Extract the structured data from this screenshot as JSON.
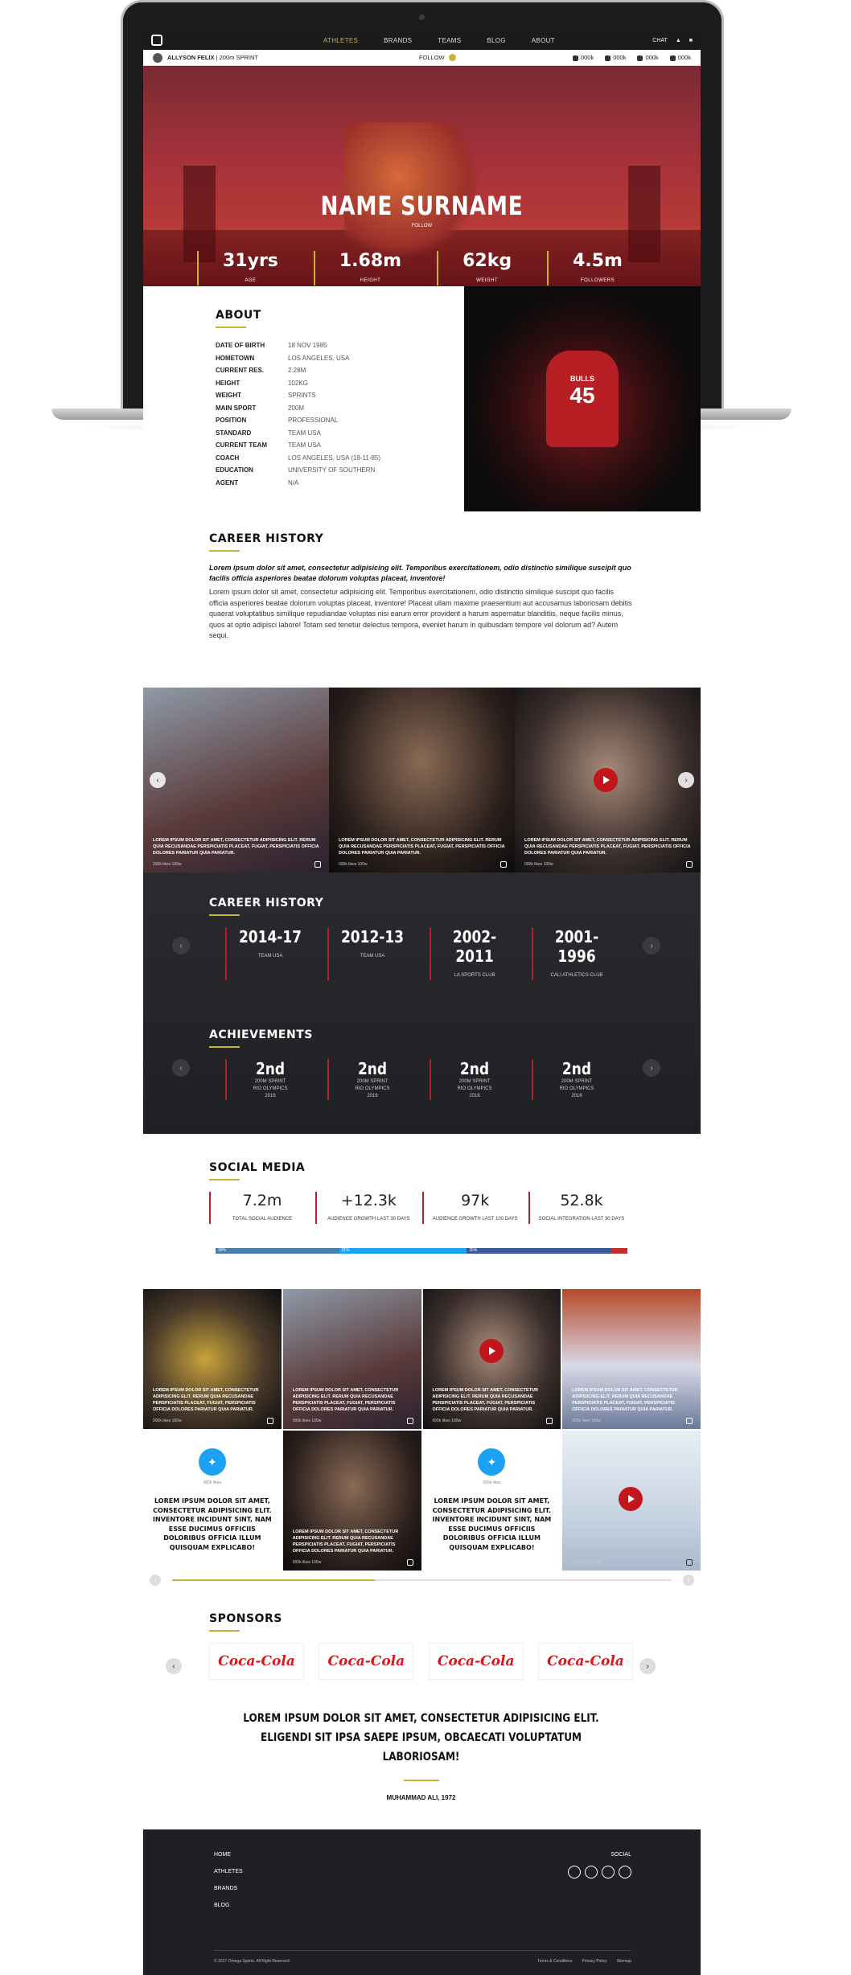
{
  "nav": {
    "items": [
      "ATHLETES",
      "BRANDS",
      "TEAMS",
      "BLOG",
      "ABOUT"
    ],
    "active": "ATHLETES",
    "chat": "CHAT"
  },
  "subbar": {
    "athlete": "ALLYSON FELIX",
    "event": "200m SPRINT",
    "follow": "FOLLOW",
    "youtube": "000k",
    "instagram": "000k",
    "twitter": "000k",
    "facebook": "000k"
  },
  "hero": {
    "name": "NAME SURNAME",
    "follow": "FOLLOW",
    "stats": [
      {
        "value": "31yrs",
        "label": "AGE"
      },
      {
        "value": "1.68m",
        "label": "HEIGHT"
      },
      {
        "value": "62kg",
        "label": "WEIGHT"
      },
      {
        "value": "4.5m",
        "label": "FOLLOWERS"
      }
    ]
  },
  "about": {
    "title": "ABOUT",
    "rows": [
      {
        "k": "DATE OF BIRTH",
        "v": "18 NOV 1985"
      },
      {
        "k": "HOMETOWN",
        "v": "LOS ANGELES, USA"
      },
      {
        "k": "CURRENT RES.",
        "v": "2.28M"
      },
      {
        "k": "HEIGHT",
        "v": "102KG"
      },
      {
        "k": "WEIGHT",
        "v": "SPRINTS"
      },
      {
        "k": "MAIN SPORT",
        "v": "200M"
      },
      {
        "k": "POSITION",
        "v": "PROFESSIONAL"
      },
      {
        "k": "STANDARD",
        "v": "TEAM USA"
      },
      {
        "k": "CURRENT TEAM",
        "v": "TEAM USA"
      },
      {
        "k": "COACH",
        "v": "LOS ANGELES, USA (18-11-85)"
      },
      {
        "k": "EDUCATION",
        "v": "UNIVERSITY OF SOUTHERN"
      },
      {
        "k": "AGENT",
        "v": "N/A"
      }
    ],
    "jersey": {
      "team": "BULLS",
      "number": "45"
    }
  },
  "career_text": {
    "title": "CAREER HISTORY",
    "lead": "Lorem ipsum dolor sit amet, consectetur adipisicing elit. Temporibus exercitationem, odio distinctio similique suscipit quo facilis officia asperiores beatae dolorum voluptas placeat, inventore!",
    "body": "Lorem ipsum dolor sit amet, consectetur adipisicing elit. Temporibus exercitationem, odio distinctio similique suscipit quo facilis officia asperiores beatae dolorum voluptas placeat, inventore! Placeat ullam maxime praesentium aut accusamus laboriosam debitis quaerat voluptatibus similique repudiandae voluptas nisi earum error provident a harum aspernatur blanditiis, neque facilis minus, quos at optio adipisci labore! Totam sed tenetur delectus tempora, eveniet harum in quibusdam tempore vel dolorum ad? Autem sequi."
  },
  "strip": {
    "caption": "LOREM IPSUM DOLOR SIT AMET, CONSECTETUR ADIPISICING ELIT. RERUM QUIA RECUSANDAE PERSPICIATIS PLACEAT, FUGIAT, PERSPICIATIS OFFICIA DOLORES PARIATUR QUIA PARIATUR.",
    "meta": "000k likes 100w"
  },
  "dark": {
    "career_title": "CAREER HISTORY",
    "career": [
      {
        "y": "2014-17",
        "t": "TEAM USA"
      },
      {
        "y": "2012-13",
        "t": "TEAM USA"
      },
      {
        "y": "2002-2011",
        "t": "LA SPORTS CLUB"
      },
      {
        "y": "2001-1996",
        "t": "CALI ATHLETICS CLUB"
      }
    ],
    "ach_title": "ACHIEVEMENTS",
    "ach": [
      {
        "p": "2nd",
        "e": "200M SPRINT",
        "c": "RIO OLYMPICS",
        "y": "2016"
      },
      {
        "p": "2nd",
        "e": "200M SPRINT",
        "c": "RIO OLYMPICS",
        "y": "2016"
      },
      {
        "p": "2nd",
        "e": "200M SPRINT",
        "c": "RIO OLYMPICS",
        "y": "2016"
      },
      {
        "p": "2nd",
        "e": "200M SPRINT",
        "c": "RIO OLYMPICS",
        "y": "2016"
      }
    ]
  },
  "social": {
    "title": "SOCIAL MEDIA",
    "stats": [
      {
        "v": "7.2m",
        "l": "TOTAL SOCIAL AUDIENCE"
      },
      {
        "v": "+12.3k",
        "l": "AUDIENCE GROWTH LAST 30 DAYS"
      },
      {
        "v": "97k",
        "l": "AUDIENCE GROWTH LAST 100 DAYS"
      },
      {
        "v": "52.8k",
        "l": "SOCIAL INTEGRATION LAST 30 DAYS"
      }
    ],
    "bar": [
      {
        "label": "30%",
        "pct": 30,
        "color": "#4a7fa7"
      },
      {
        "label": "31%",
        "pct": 31,
        "color": "#1da1f2"
      },
      {
        "label": "35%",
        "pct": 35,
        "color": "#3b5998"
      },
      {
        "label": "",
        "pct": 4,
        "color": "#c4302b"
      }
    ]
  },
  "grid": {
    "caption": "LOREM IPSUM DOLOR SIT AMET, CONSECTETUR ADIPISICING ELIT. RERUM QUIA RECUSANDAE PERSPICIATIS PLACEAT, FUGIAT, PERSPICIATIS OFFICIA DOLORES PARIATUR QUIA PARIATUR.",
    "meta": "000k likes 100w",
    "tweet": "LOREM IPSUM DOLOR SIT AMET, CONSECTETUR ADIPISICING ELIT. INVENTORE INCIDUNT SINT, NAM ESSE DUCIMUS OFFICIIS DOLORIBUS OFFICIA ILLUM QUISQUAM EXPLICABO!",
    "tweet_meta": "000k likes"
  },
  "sponsors": {
    "title": "SPONSORS",
    "logo": "Coca-Cola",
    "quote": "LOREM IPSUM DOLOR SIT AMET, CONSECTETUR ADIPISICING ELIT. ELIGENDI SIT IPSA SAEPE IPSUM, OBCAECATI VOLUPTATUM LABORIOSAM!",
    "author": "MUHAMMAD ALI, 1972"
  },
  "footer": {
    "links": [
      "HOME",
      "ATHLETES",
      "BRANDS",
      "BLOG"
    ],
    "social": "SOCIAL",
    "copyright": "© 2017 Omega Sports. All Right Reserved",
    "terms": "Terms & Conditions",
    "privacy": "Privacy Policy",
    "sitemap": "Sitemap"
  },
  "colors": {
    "accent": "#c9b23a",
    "red": "#b81f24",
    "dark": "#1f2023"
  }
}
